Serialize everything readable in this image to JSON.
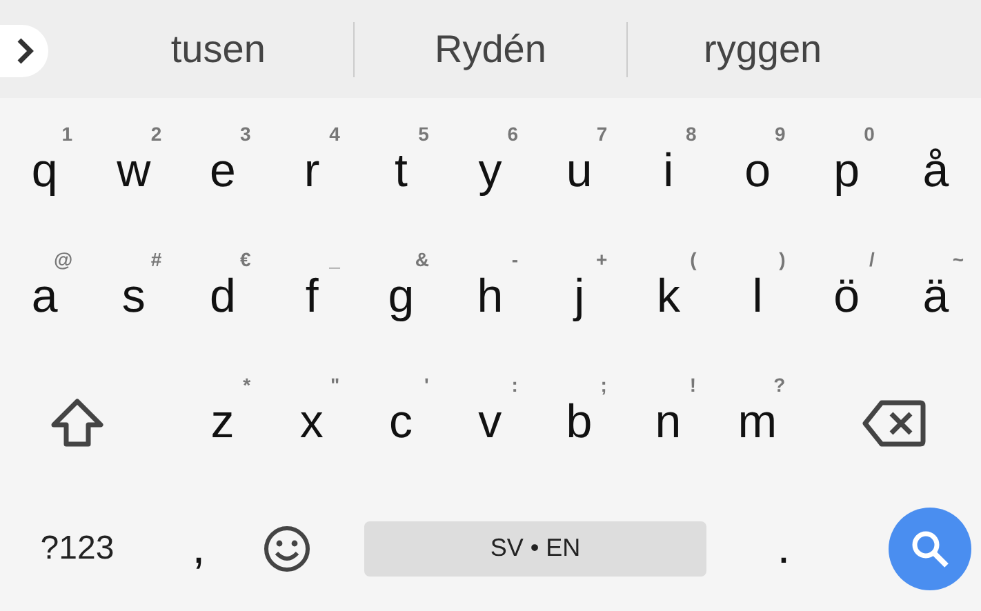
{
  "suggestions": [
    "tusen",
    "Rydén",
    "ryggen"
  ],
  "rows": [
    [
      {
        "kind": "letter",
        "label": "q",
        "hint": "1"
      },
      {
        "kind": "letter",
        "label": "w",
        "hint": "2"
      },
      {
        "kind": "letter",
        "label": "e",
        "hint": "3"
      },
      {
        "kind": "letter",
        "label": "r",
        "hint": "4"
      },
      {
        "kind": "letter",
        "label": "t",
        "hint": "5"
      },
      {
        "kind": "letter",
        "label": "y",
        "hint": "6"
      },
      {
        "kind": "letter",
        "label": "u",
        "hint": "7"
      },
      {
        "kind": "letter",
        "label": "i",
        "hint": "8"
      },
      {
        "kind": "letter",
        "label": "o",
        "hint": "9"
      },
      {
        "kind": "letter",
        "label": "p",
        "hint": "0"
      },
      {
        "kind": "letter",
        "label": "å"
      }
    ],
    [
      {
        "kind": "letter",
        "label": "a",
        "hint": "@"
      },
      {
        "kind": "letter",
        "label": "s",
        "hint": "#"
      },
      {
        "kind": "letter",
        "label": "d",
        "hint": "€"
      },
      {
        "kind": "letter",
        "label": "f",
        "hint": "_"
      },
      {
        "kind": "letter",
        "label": "g",
        "hint": "&"
      },
      {
        "kind": "letter",
        "label": "h",
        "hint": "-"
      },
      {
        "kind": "letter",
        "label": "j",
        "hint": "+"
      },
      {
        "kind": "letter",
        "label": "k",
        "hint": "("
      },
      {
        "kind": "letter",
        "label": "l",
        "hint": ")"
      },
      {
        "kind": "letter",
        "label": "ö",
        "hint": "/"
      },
      {
        "kind": "letter",
        "label": "ä",
        "hint": "~"
      }
    ],
    [
      {
        "kind": "shift"
      },
      {
        "kind": "letter",
        "label": "z",
        "hint": "*"
      },
      {
        "kind": "letter",
        "label": "x",
        "hint": "\""
      },
      {
        "kind": "letter",
        "label": "c",
        "hint": "'"
      },
      {
        "kind": "letter",
        "label": "v",
        "hint": ":"
      },
      {
        "kind": "letter",
        "label": "b",
        "hint": ";"
      },
      {
        "kind": "letter",
        "label": "n",
        "hint": "!"
      },
      {
        "kind": "letter",
        "label": "m",
        "hint": "?"
      },
      {
        "kind": "backspace"
      }
    ],
    [
      {
        "kind": "symbols",
        "label": "?123"
      },
      {
        "kind": "letter",
        "label": ","
      },
      {
        "kind": "emoji"
      },
      {
        "kind": "space",
        "label": "SV • EN"
      },
      {
        "kind": "letter",
        "label": "."
      },
      {
        "kind": "search"
      }
    ]
  ]
}
